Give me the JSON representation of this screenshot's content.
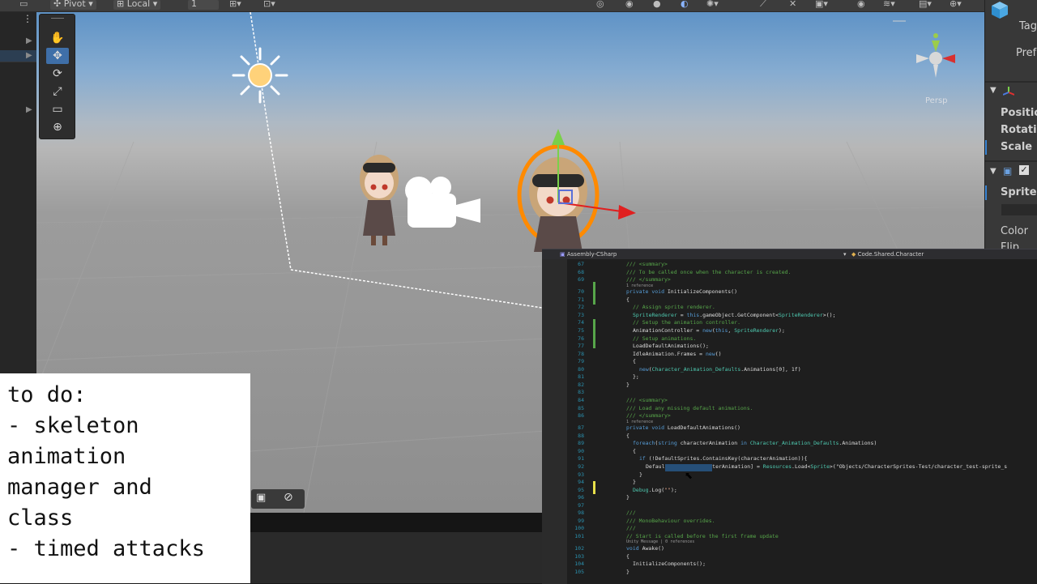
{
  "toolbar": {
    "pivot_label": "Pivot",
    "local_label": "Local",
    "snap_value": "1"
  },
  "scene": {
    "persp_label": "Persp"
  },
  "inspector": {
    "tag_label": "Tag",
    "prefab_label": "Prefab",
    "position_label": "Position",
    "rotation_label": "Rotation",
    "scale_label": "Scale",
    "sprite_label": "Sprite",
    "color_label": "Color",
    "flip_label": "Flip"
  },
  "editor": {
    "project_dropdown": "Assembly-CSharp",
    "class_dropdown": "Code.Shared.Character",
    "lines": [
      {
        "n": "67",
        "text": "/// <summary>"
      },
      {
        "n": "68",
        "text": "/// To be called once when the character is created."
      },
      {
        "n": "69",
        "text": "/// </summary>"
      },
      {
        "n": "70",
        "text": "private void InitializeComponents()"
      },
      {
        "n": "71",
        "text": "{"
      },
      {
        "n": "72",
        "text": "// Assign sprite renderer."
      },
      {
        "n": "73",
        "text": "SpriteRenderer = this.gameObject.GetComponent<SpriteRenderer>();"
      },
      {
        "n": "74",
        "text": "// Setup the animation controller."
      },
      {
        "n": "75",
        "text": "AnimationController = new(this, SpriteRenderer);"
      },
      {
        "n": "76",
        "text": "// Setup animations."
      },
      {
        "n": "77",
        "text": "LoadDefaultAnimations();"
      },
      {
        "n": "78",
        "text": "IdleAnimation.Frames = new()"
      },
      {
        "n": "79",
        "text": "{"
      },
      {
        "n": "80",
        "text": "new(Character_Animation_Defaults.Animations[0], 1f)"
      },
      {
        "n": "81",
        "text": "};"
      },
      {
        "n": "82",
        "text": "}"
      },
      {
        "n": "83",
        "text": ""
      },
      {
        "n": "84",
        "text": "/// <summary>"
      },
      {
        "n": "85",
        "text": "/// Load any missing default animations."
      },
      {
        "n": "86",
        "text": "/// </summary>"
      },
      {
        "n": "87",
        "text": "private void LoadDefaultAnimations()"
      },
      {
        "n": "88",
        "text": "{"
      },
      {
        "n": "89",
        "text": "foreach(string characterAnimation in Character_Animation_Defaults.Animations)"
      },
      {
        "n": "90",
        "text": "{"
      },
      {
        "n": "91",
        "text": "if (!DefaultSprites.ContainsKey(characterAnimation)){"
      },
      {
        "n": "92",
        "text": "DefaultSprites[characterAnimation] = Resources.Load<Sprite>(\"Objects/CharacterSprites-Test/character_test-sprite_s"
      },
      {
        "n": "93",
        "text": "}"
      },
      {
        "n": "94",
        "text": "}"
      },
      {
        "n": "95",
        "text": "Debug.Log(\"\");"
      },
      {
        "n": "96",
        "text": "}"
      },
      {
        "n": "97",
        "text": ""
      },
      {
        "n": "98",
        "text": "///"
      },
      {
        "n": "99",
        "text": "/// MonoBehaviour overrides."
      },
      {
        "n": "100",
        "text": "///"
      },
      {
        "n": "101",
        "text": "// Start is called before the first frame update"
      },
      {
        "n": "102",
        "text": "void Awake()"
      },
      {
        "n": "103",
        "text": "{"
      },
      {
        "n": "104",
        "text": "InitializeComponents();"
      },
      {
        "n": "105",
        "text": "}"
      }
    ],
    "codelens_1": "1 reference",
    "codelens_2": "1 reference",
    "codelens_3": "Unity Message | 0 references"
  },
  "note": {
    "text": "to do:\n- skeleton\nanimation\nmanager and\nclass\n- timed attacks"
  }
}
